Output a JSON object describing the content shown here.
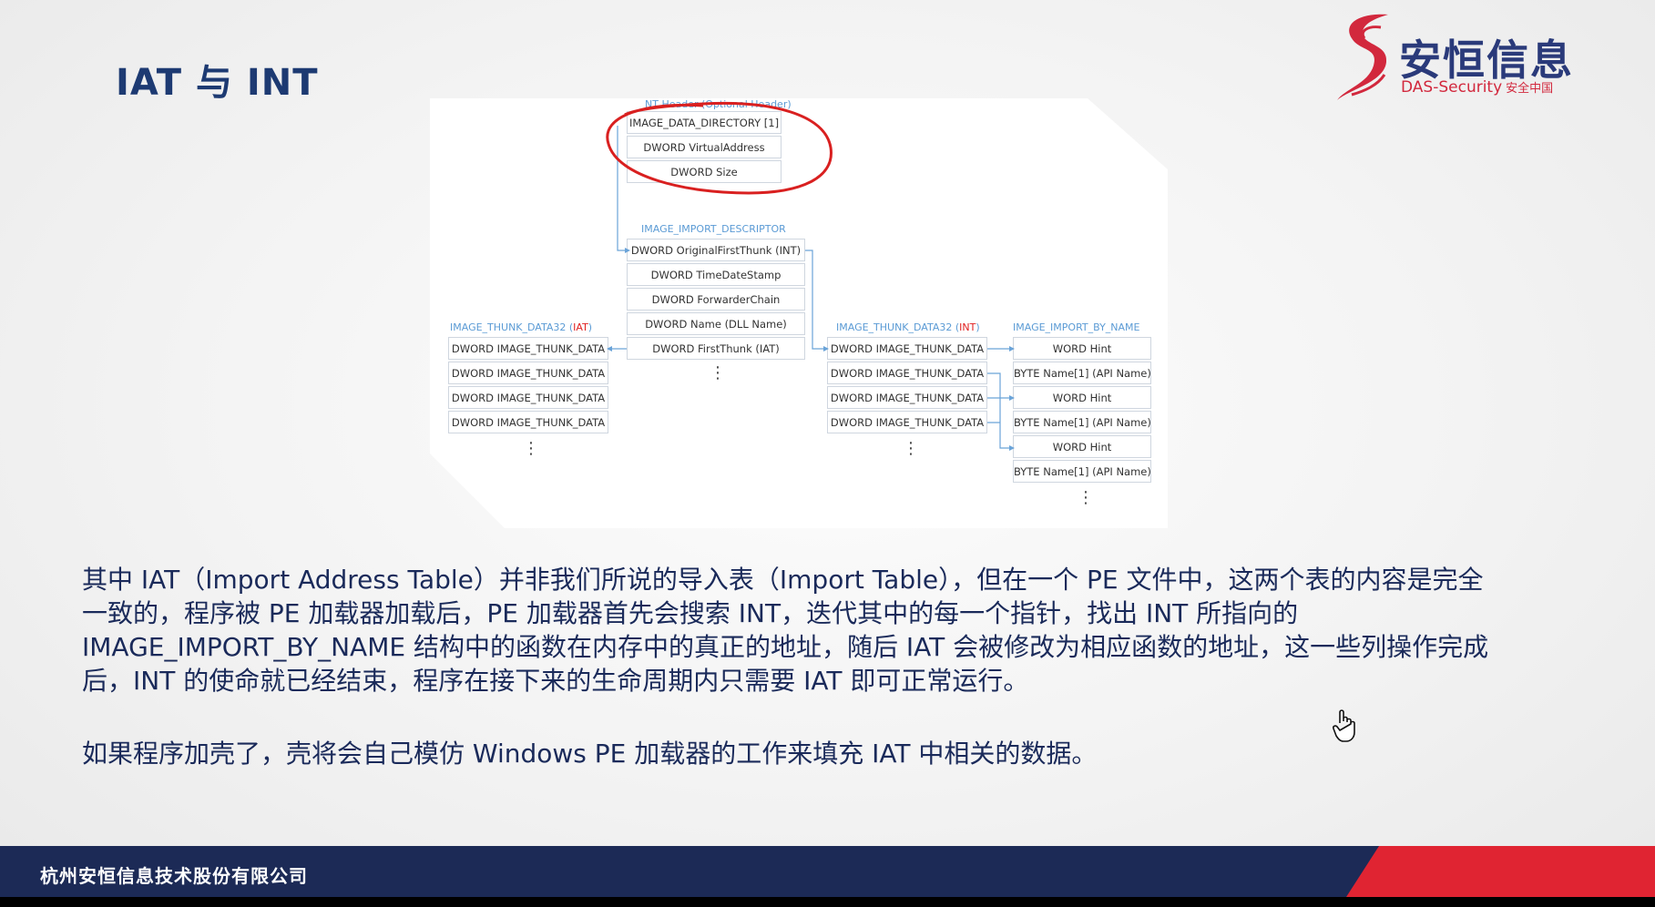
{
  "slide": {
    "title": "IAT 与 INT",
    "logo": {
      "cn_name": "安恒信息",
      "en_name": "DAS-Security",
      "cn_tagline": "安全中国"
    },
    "footer": "杭州安恒信息技术股份有限公司",
    "colors": {
      "title": "#1d3a72",
      "footer_bar": "#1c2a56",
      "accent_red": "#e02432",
      "diagram_label_blue": "#5b9bd5"
    }
  },
  "diagram": {
    "nt_header_label": "NT Header (Optional Header)",
    "nt_header_rows": [
      "IMAGE_DATA_DIRECTORY [1]",
      "DWORD VirtualAddress",
      "DWORD Size"
    ],
    "descriptor_label": "IMAGE_IMPORT_DESCRIPTOR",
    "descriptor_rows": [
      "DWORD OriginalFirstThunk (INT)",
      "DWORD TimeDateStamp",
      "DWORD ForwarderChain",
      "DWORD Name (DLL Name)",
      "DWORD FirstThunk (IAT)"
    ],
    "iat_label_prefix": "IMAGE_THUNK_DATA32 (",
    "iat_label_highlight": "IAT",
    "iat_label_suffix": ")",
    "iat_rows": [
      "DWORD IMAGE_THUNK_DATA",
      "DWORD IMAGE_THUNK_DATA",
      "DWORD IMAGE_THUNK_DATA",
      "DWORD IMAGE_THUNK_DATA"
    ],
    "int_label_prefix": "IMAGE_THUNK_DATA32 (",
    "int_label_highlight": "INT",
    "int_label_suffix": ")",
    "int_rows": [
      "DWORD IMAGE_THUNK_DATA",
      "DWORD IMAGE_THUNK_DATA",
      "DWORD IMAGE_THUNK_DATA",
      "DWORD IMAGE_THUNK_DATA"
    ],
    "by_name_label": "IMAGE_IMPORT_BY_NAME",
    "by_name_rows": [
      "WORD Hint",
      "BYTE Name[1] (API Name)",
      "WORD Hint",
      "BYTE Name[1] (API Name)",
      "WORD Hint",
      "BYTE Name[1] (API Name)"
    ],
    "ellipsis": "⋮"
  },
  "body": {
    "paragraph1": "其中 IAT（Import Address Table）并非我们所说的导入表（Import Table），但在一个 PE 文件中，这两个表的内容是完全一致的，程序被 PE 加载器加载后，PE 加载器首先会搜索 INT，迭代其中的每一个指针，找出 INT 所指向的 IMAGE_IMPORT_BY_NAME 结构中的函数在内存中的真正的地址，随后 IAT 会被修改为相应函数的地址，这一些列操作完成后，INT 的使命就已经结束，程序在接下来的生命周期内只需要 IAT 即可正常运行。",
    "paragraph2": "如果程序加壳了，壳将会自己模仿 Windows PE 加载器的工作来填充 IAT 中相关的数据。"
  },
  "cursor_icon": "hand-pointer-icon"
}
